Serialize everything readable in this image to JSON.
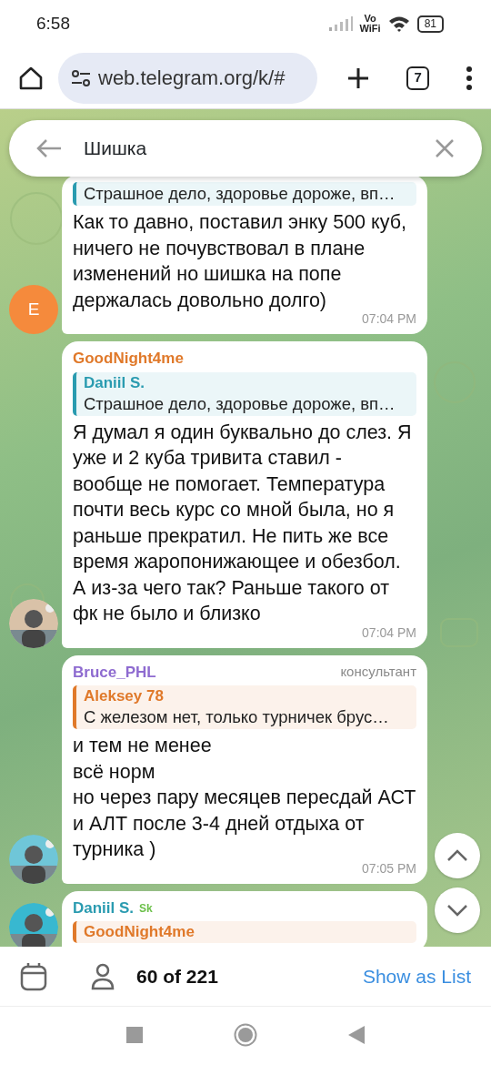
{
  "status_bar": {
    "time": "6:58",
    "volte": [
      "Vo",
      "WiFi"
    ],
    "battery": "81"
  },
  "browser": {
    "url": "web.telegram.org/k/#",
    "tab_count": "7"
  },
  "search": {
    "value": "Шишка"
  },
  "messages": [
    {
      "avatar": {
        "kind": "letter",
        "letter": "E",
        "color": "#f58a3c"
      },
      "reply": {
        "text": "Страшное дело, здоровье дороже, вп…",
        "color": "#2a9bb0"
      },
      "text": "Как то давно, поставил энку 500 куб, ничего не почувствовал в плане изменений но шишка на попе держалась довольно долго)",
      "time": "07:04 PM"
    },
    {
      "sender": {
        "name": "GoodNight4me",
        "color": "#e0792a"
      },
      "reply": {
        "name": "Daniil S.",
        "text": "Страшное дело, здоровье дороже, вп…",
        "color": "#2a9bb0"
      },
      "text": "Я думал я один буквально до слез. Я уже и 2 куба тривита ставил - вообще не помогает. Температура почти весь курс со мной была, но я раньше прекратил. Не пить же все время жаропонижающее и обезбол. А из-за чего так? Раньше такого от фк не было и близко",
      "time": "07:04 PM"
    },
    {
      "sender": {
        "name": "Bruce_PHL",
        "color": "#8e6bd0"
      },
      "role": "консультант",
      "reply": {
        "name": "Aleksey 78",
        "text": "С железом нет, только турничек брус…",
        "color": "#e0792a"
      },
      "text": "и тем не менее\nвсё норм\nно через пару месяцев пересдай АСТ и АЛТ после 3-4 дней отдыха от турника )",
      "time": "07:05 PM"
    },
    {
      "sender": {
        "name": "Daniil S.",
        "color": "#2a9bb0",
        "badge": "Sk"
      },
      "reply": {
        "name": "GoodNight4me",
        "color": "#e0792a"
      }
    }
  ],
  "footer": {
    "count": "60 of 221",
    "link": "Show as List"
  }
}
